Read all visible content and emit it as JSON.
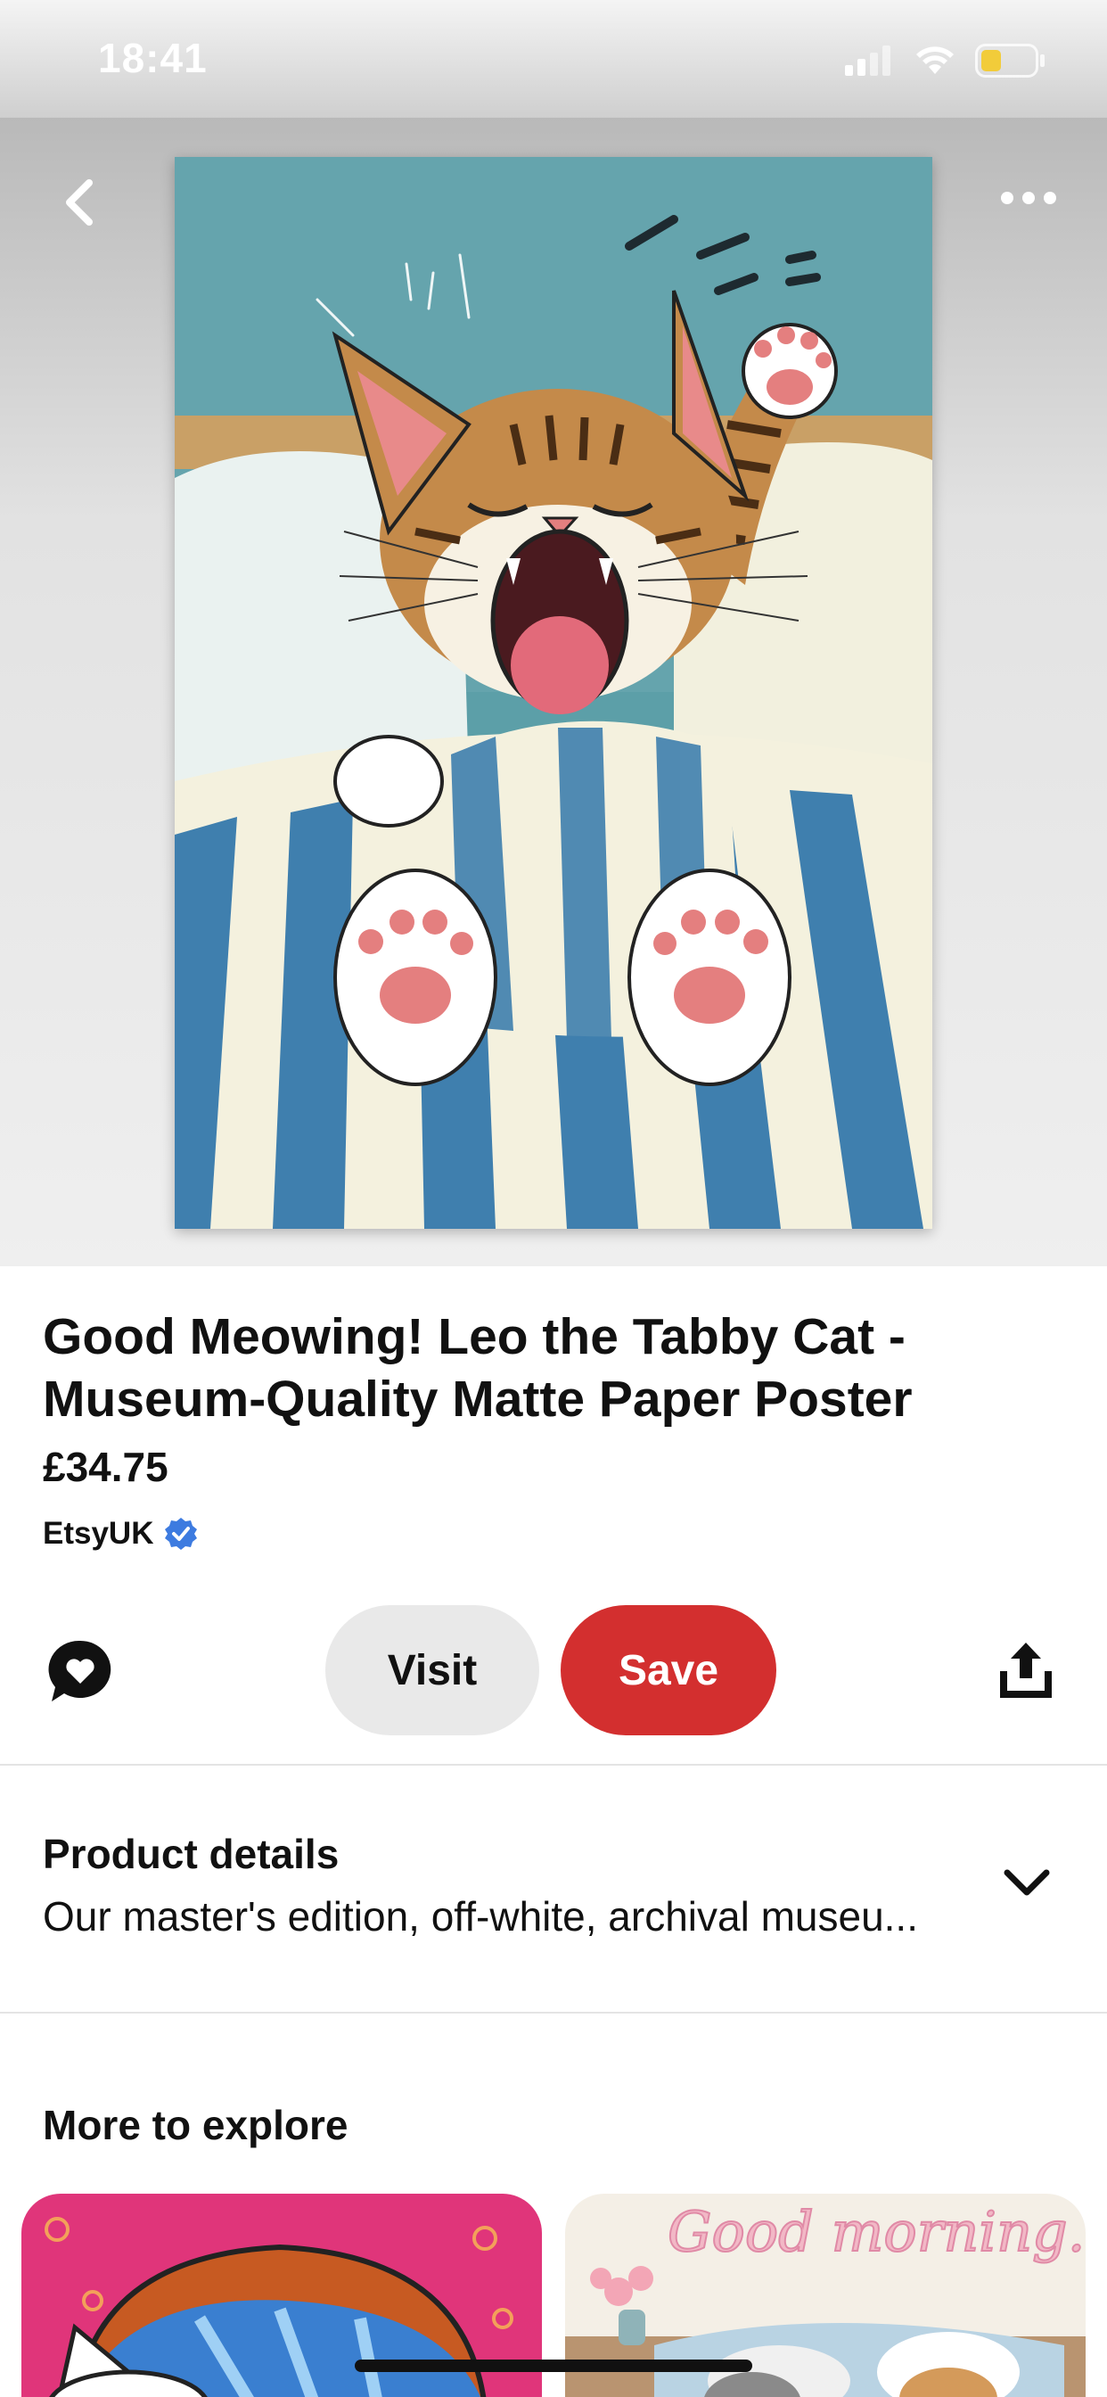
{
  "status_bar": {
    "time": "18:41",
    "icons": [
      "cellular-signal-icon",
      "wifi-icon",
      "battery-icon"
    ],
    "battery_color": "#f2cc3a"
  },
  "hero": {
    "back_icon": "chevron-left-icon",
    "more_icon": "more-horizontal-icon"
  },
  "pin": {
    "title": "Good Meowing! Leo the Tabby Cat - Museum-Quality Matte Paper Poster",
    "price": "£34.75",
    "seller": "EtsyUK",
    "seller_verified_icon": "verified-check-icon"
  },
  "actions": {
    "comment_icon": "comment-heart-icon",
    "visit_label": "Visit",
    "save_label": "Save",
    "share_icon": "share-upload-icon",
    "save_color": "#d32f2f"
  },
  "product_details": {
    "heading": "Product details",
    "summary": "Our master's edition, off-white, archival museu...",
    "expand_icon": "chevron-down-icon"
  },
  "explore": {
    "heading": "More to explore",
    "thumb2_text": "Good morning."
  }
}
